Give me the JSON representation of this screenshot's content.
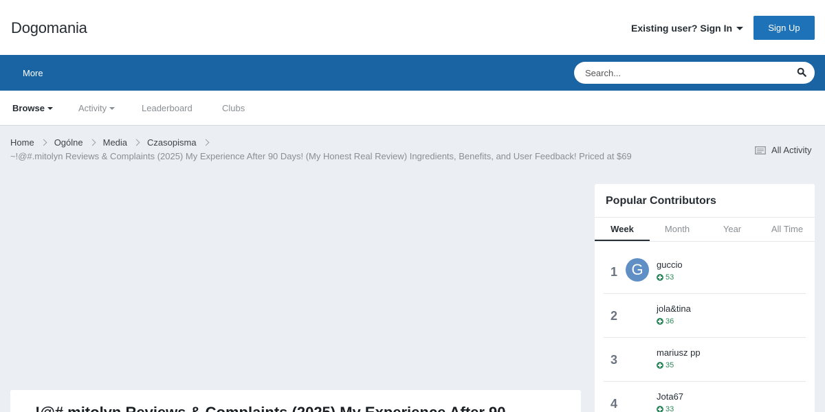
{
  "header": {
    "logo": "Dogomania",
    "signin_label": "Existing user? Sign In",
    "signup_label": "Sign Up"
  },
  "navbar": {
    "more_label": "More",
    "search_placeholder": "Search..."
  },
  "subnav": {
    "items": [
      {
        "label": "Browse",
        "active": true,
        "dropdown": true
      },
      {
        "label": "Activity",
        "active": false,
        "dropdown": true
      },
      {
        "label": "Leaderboard",
        "active": false,
        "dropdown": false
      },
      {
        "label": "Clubs",
        "active": false,
        "dropdown": false
      }
    ]
  },
  "breadcrumb": {
    "items": [
      "Home",
      "Ogólne",
      "Media",
      "Czasopisma"
    ],
    "current": "~!@#.mitolyn Reviews & Complaints (2025) My Experience After 90 Days! (My Honest Real Review) Ingredients, Benefits, and User Feedback! Priced at $69",
    "all_activity": "All Activity"
  },
  "post": {
    "title": "!@#.mitolyn Reviews & Complaints (2025) My Experience After 90"
  },
  "widget": {
    "title": "Popular Contributors",
    "tabs": [
      "Week",
      "Month",
      "Year",
      "All Time"
    ],
    "active_tab": "Week",
    "leaders": [
      {
        "rank": "1",
        "name": "guccio",
        "score": "53",
        "avatar_letter": "G"
      },
      {
        "rank": "2",
        "name": "jola&tina",
        "score": "36",
        "avatar_letter": ""
      },
      {
        "rank": "3",
        "name": "mariusz pp",
        "score": "35",
        "avatar_letter": ""
      },
      {
        "rank": "4",
        "name": "Jota67",
        "score": "33",
        "avatar_letter": ""
      }
    ]
  },
  "colors": {
    "brand_blue": "#1b64a3",
    "button_blue": "#1d72b8",
    "positive_green": "#2d8a5b"
  }
}
